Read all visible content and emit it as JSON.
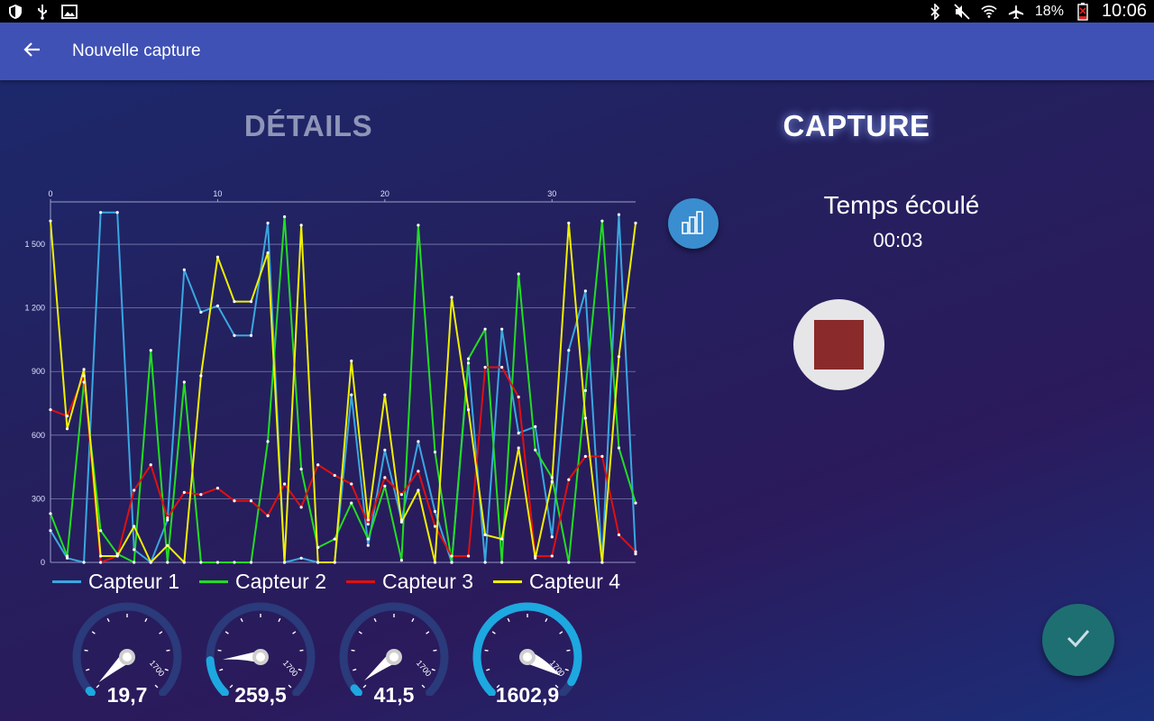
{
  "status_bar": {
    "left_icons": [
      "shield-icon",
      "usb-icon",
      "image-icon"
    ],
    "right_icons": [
      "bluetooth-icon",
      "mute-icon",
      "wifi-icon",
      "airplane-icon",
      "battery-icon"
    ],
    "battery": "18%",
    "time": "10:06"
  },
  "app_bar": {
    "title": "Nouvelle capture",
    "back_icon": "arrow-back-icon"
  },
  "tabs": [
    {
      "label": "DÉTAILS",
      "active": false
    },
    {
      "label": "CAPTURE",
      "active": true
    }
  ],
  "chart_data": {
    "type": "line",
    "x": [
      0,
      1,
      2,
      3,
      4,
      5,
      6,
      7,
      8,
      9,
      10,
      11,
      12,
      13,
      14,
      15,
      16,
      17,
      18,
      19,
      20,
      21,
      22,
      23,
      24,
      25,
      26,
      27,
      28,
      29,
      30,
      31,
      32,
      33,
      34,
      35
    ],
    "xticks": [
      0,
      10,
      20,
      30
    ],
    "xlim": [
      0,
      35
    ],
    "ylim": [
      0,
      1700
    ],
    "yticks": [
      0,
      300,
      600,
      900,
      1200,
      1500
    ],
    "ytick_labels": [
      "0",
      "300",
      "600",
      "900",
      "1 200",
      "1 500"
    ],
    "grid": "horizontal",
    "legend_position": "bottom",
    "series": [
      {
        "name": "Capteur 1",
        "color": "#3aa7e0",
        "values": [
          150,
          20,
          0,
          1650,
          1650,
          60,
          0,
          200,
          1380,
          1180,
          1210,
          1070,
          1070,
          1600,
          0,
          20,
          0,
          0,
          790,
          80,
          530,
          200,
          570,
          240,
          0,
          940,
          0,
          1100,
          610,
          640,
          120,
          1000,
          1280,
          0,
          1640,
          40
        ]
      },
      {
        "name": "Capteur 2",
        "color": "#22dd22",
        "values": [
          230,
          30,
          850,
          150,
          40,
          0,
          1000,
          0,
          850,
          0,
          0,
          0,
          0,
          570,
          1630,
          440,
          70,
          110,
          280,
          110,
          360,
          10,
          1590,
          520,
          0,
          960,
          1100,
          0,
          1360,
          530,
          400,
          0,
          810,
          1610,
          540,
          280
        ]
      },
      {
        "name": "Capteur 3",
        "color": "#e01010",
        "values": [
          720,
          690,
          880,
          0,
          30,
          340,
          460,
          210,
          330,
          320,
          350,
          290,
          290,
          220,
          370,
          260,
          460,
          410,
          370,
          180,
          400,
          320,
          430,
          170,
          30,
          30,
          920,
          920,
          780,
          30,
          30,
          390,
          500,
          500,
          130,
          50
        ]
      },
      {
        "name": "Capteur 4",
        "color": "#f0f000",
        "values": [
          1610,
          630,
          910,
          30,
          30,
          170,
          0,
          80,
          0,
          880,
          1440,
          1230,
          1230,
          1460,
          0,
          1590,
          0,
          0,
          950,
          200,
          790,
          190,
          340,
          0,
          1250,
          720,
          130,
          110,
          540,
          20,
          380,
          1600,
          680,
          0,
          970,
          1600
        ]
      }
    ]
  },
  "gauges": [
    {
      "value": "19,7",
      "fraction": 0.0116,
      "max_label": "1700"
    },
    {
      "value": "259,5",
      "fraction": 0.153,
      "max_label": "1700"
    },
    {
      "value": "41,5",
      "fraction": 0.0244,
      "max_label": "1700"
    },
    {
      "value": "1602,9",
      "fraction": 0.943,
      "max_label": "1700"
    }
  ],
  "capture": {
    "report_icon": "chart-report-icon",
    "elapsed_label": "Temps écoulé",
    "elapsed_value": "00:03",
    "stop_icon": "stop-icon",
    "confirm_icon": "check-icon"
  },
  "colors": {
    "app_bar": "#3f51b5",
    "stop": "#8b2a2a",
    "fab": "#1e6f72",
    "gauge_fill": "#1da8e0",
    "gauge_track": "#2a3a7a"
  }
}
